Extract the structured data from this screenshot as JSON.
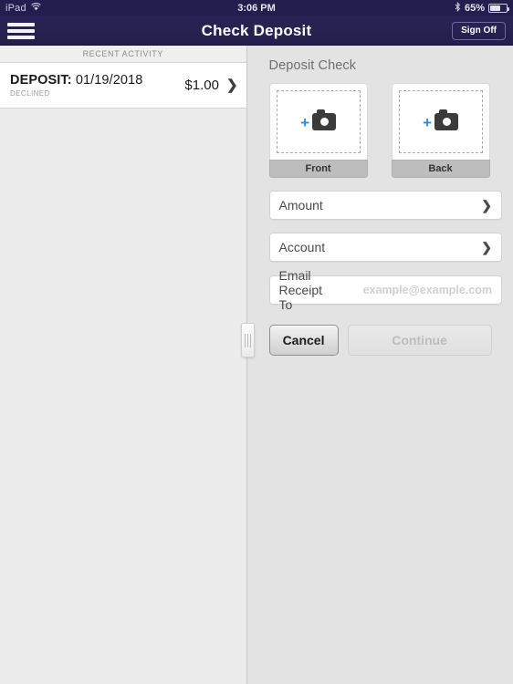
{
  "status_bar": {
    "device": "iPad",
    "wifi_icon": "wifi-icon",
    "time": "3:06 PM",
    "bluetooth_icon": "bluetooth-icon",
    "battery_percent": "65%",
    "battery_level": 65
  },
  "navbar": {
    "menu_icon": "hamburger-menu-icon",
    "title": "Check Deposit",
    "sign_off_label": "Sign Off",
    "background_color": "#241E4E"
  },
  "master": {
    "section_header": "RECENT ACTIVITY",
    "activity": [
      {
        "label": "DEPOSIT:",
        "date": "01/19/2018",
        "status": "DECLINED",
        "amount": "$1.00",
        "chevron_icon": "chevron-right-icon"
      }
    ]
  },
  "detail": {
    "title": "Deposit Check",
    "captures": [
      {
        "label": "Front",
        "icon": "camera-add-icon"
      },
      {
        "label": "Back",
        "icon": "camera-add-icon"
      }
    ],
    "fields": [
      {
        "label": "Amount",
        "value": "",
        "chevron_icon": "chevron-right-icon"
      },
      {
        "label": "Account",
        "value": "",
        "chevron_icon": "chevron-right-icon"
      }
    ],
    "email": {
      "label": "Email Receipt To",
      "value": "",
      "placeholder": "example@example.com"
    },
    "buttons": {
      "cancel": "Cancel",
      "continue": "Continue"
    },
    "accent_color": "#2f8ada",
    "drag_handle_icon": "split-view-drag-handle"
  }
}
